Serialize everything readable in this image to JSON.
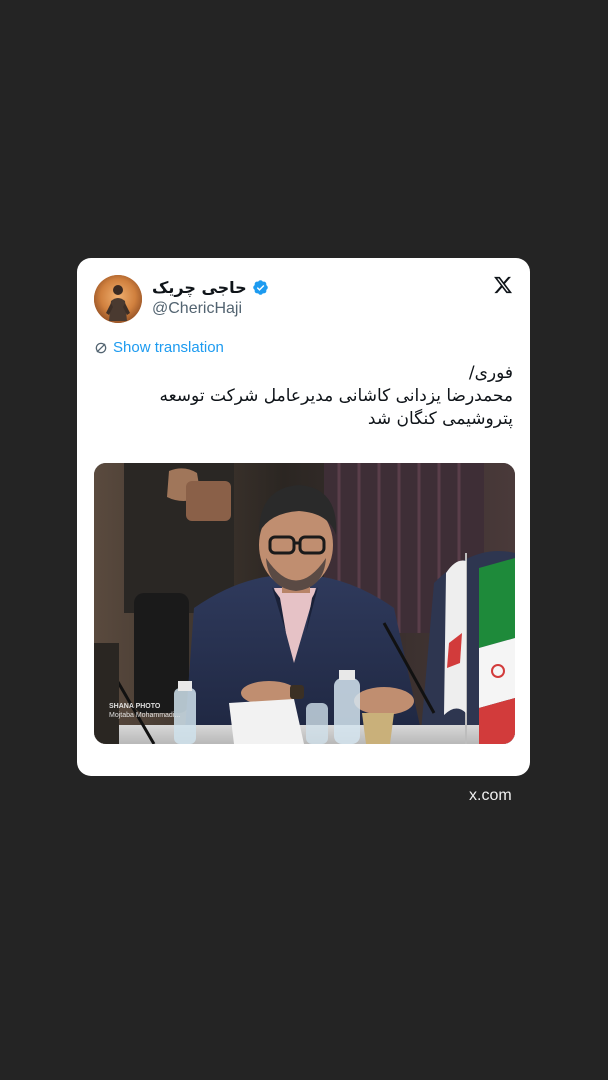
{
  "tweet": {
    "display_name": "حاجی چریک",
    "handle": "@ChericHaji",
    "verified": true,
    "translate_label": "Show translation",
    "text_lines": [
      "فوری/",
      "محمدرضا یزدانی کاشانی مدیرعامل شرکت توسعه",
      "پتروشیمی کنگان شد"
    ],
    "media": {
      "watermark_brand": "SHANA PHOTO",
      "watermark_credit": "Mojtaba Mohammadi..."
    }
  },
  "source_label": "x.com",
  "icons": {
    "brand": "x-logo-icon",
    "verified": "verified-badge-icon",
    "translate": "translate-icon"
  },
  "colors": {
    "background": "#242424",
    "card": "#ffffff",
    "link": "#1d9bf0",
    "verified": "#1d9bf0",
    "text": "#0f1419",
    "secondary_text": "#536471"
  }
}
